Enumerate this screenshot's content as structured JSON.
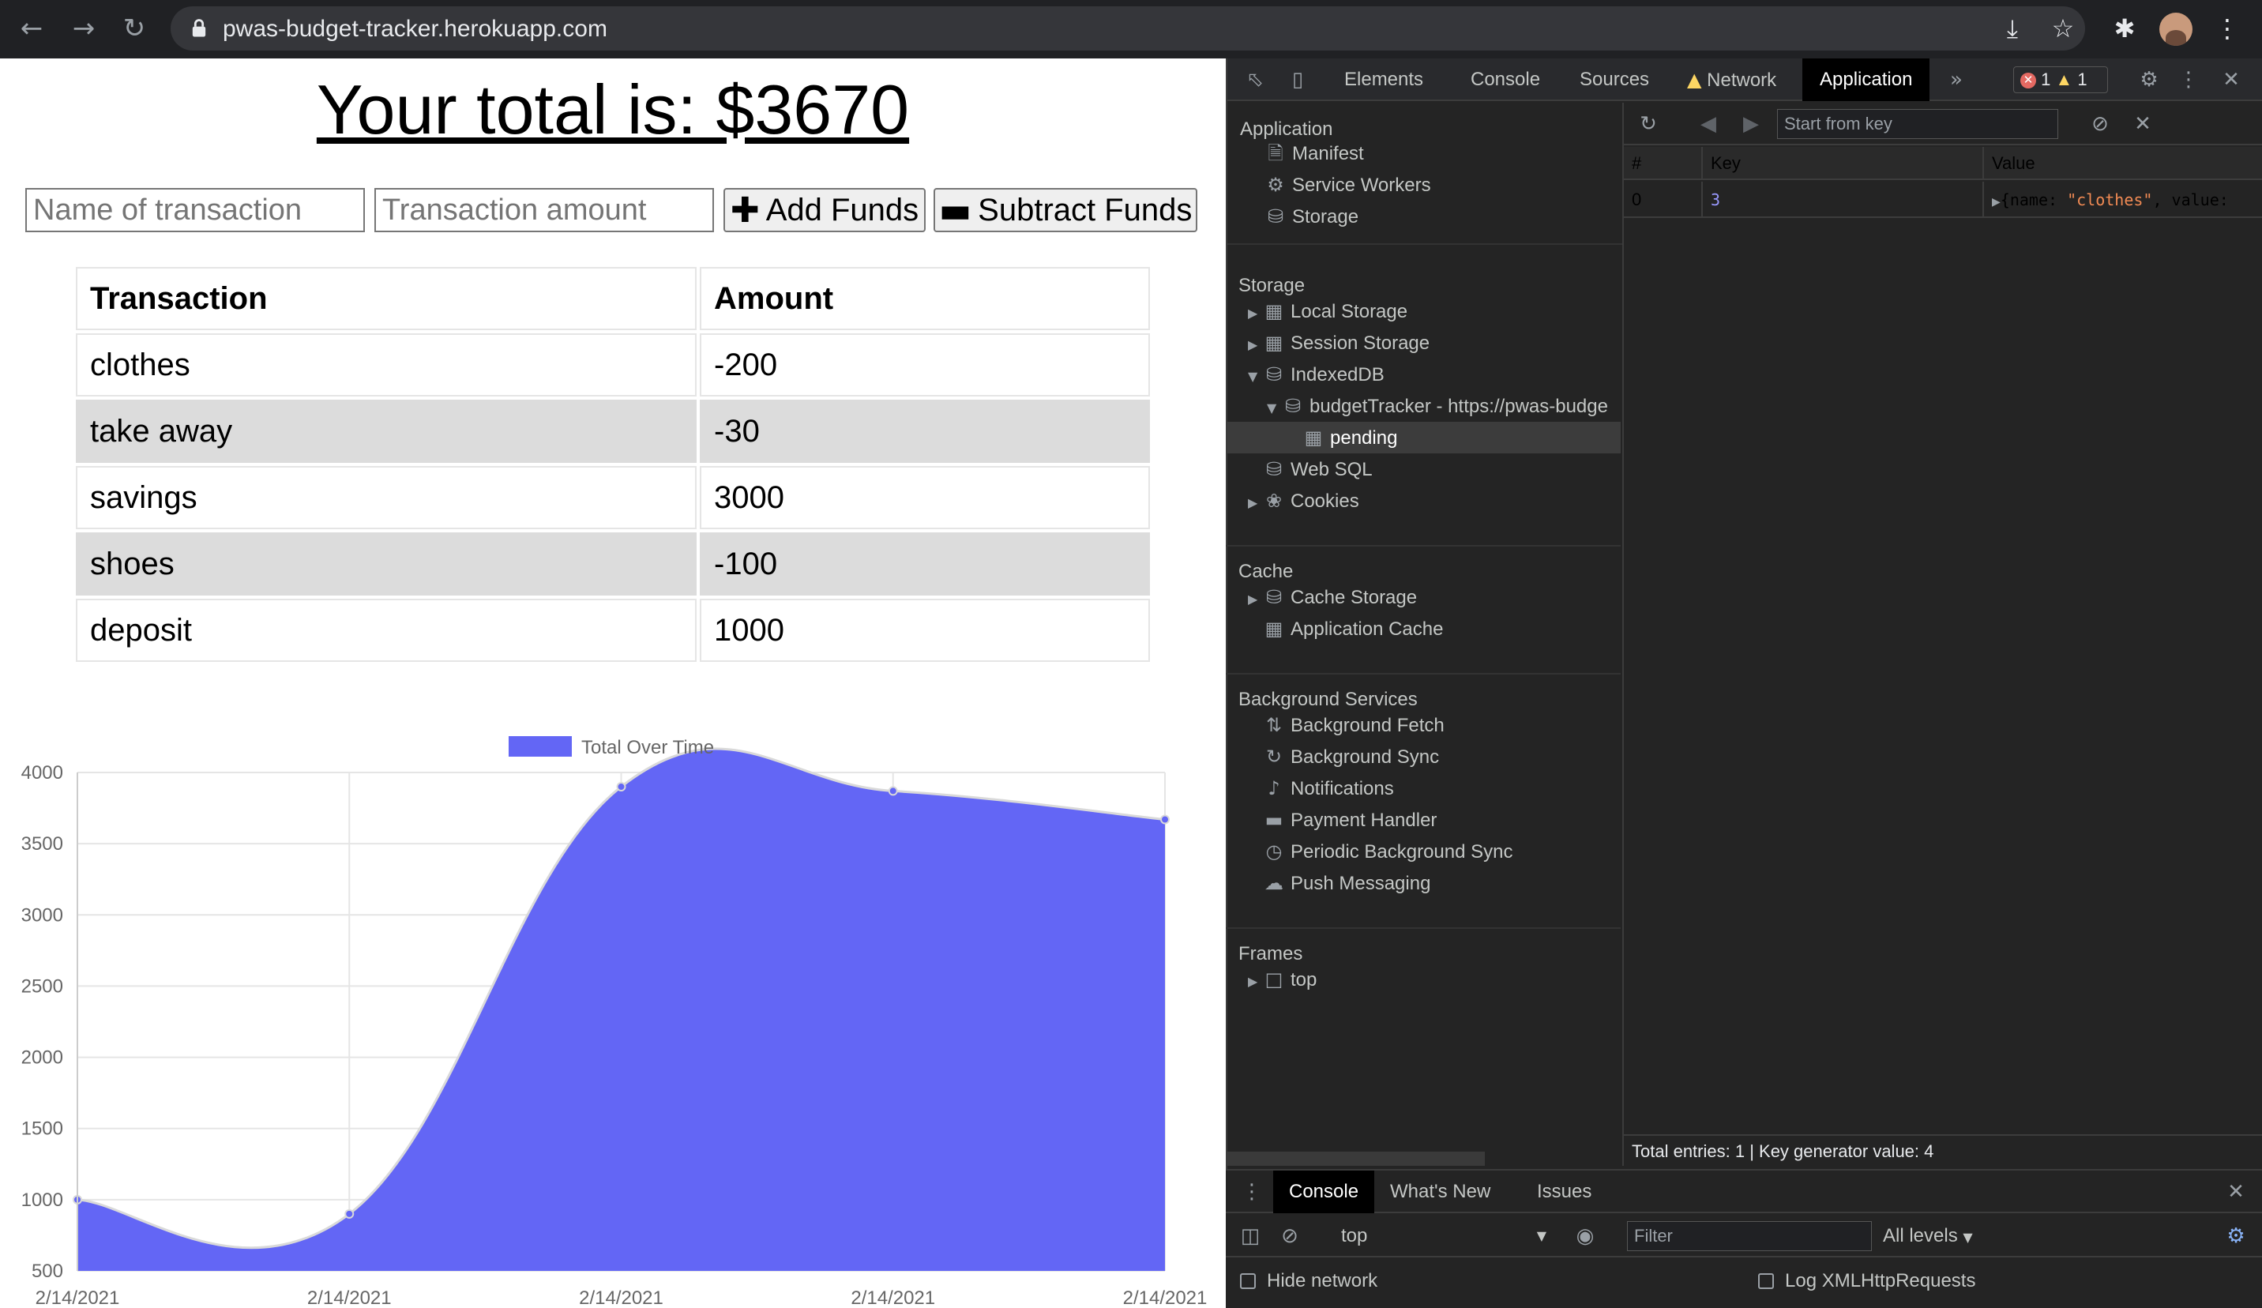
{
  "browser": {
    "url": "pwas-budget-tracker.herokuapp.com",
    "back_icon": "arrow-left",
    "forward_icon": "arrow-right",
    "reload_icon": "reload"
  },
  "page": {
    "total_text": "Your total is: $3670",
    "name_placeholder": "Name of transaction",
    "amount_placeholder": "Transaction amount",
    "add_label": "Add Funds",
    "subtract_label": "Subtract Funds",
    "table": {
      "headers": [
        "Transaction",
        "Amount"
      ],
      "rows": [
        {
          "name": "clothes",
          "amount": "-200"
        },
        {
          "name": "take away",
          "amount": "-30"
        },
        {
          "name": "savings",
          "amount": "3000"
        },
        {
          "name": "shoes",
          "amount": "-100"
        },
        {
          "name": "deposit",
          "amount": "1000"
        }
      ]
    }
  },
  "chart_data": {
    "type": "area",
    "legend": "Total Over Time",
    "x": [
      "2/14/2021",
      "2/14/2021",
      "2/14/2021",
      "2/14/2021",
      "2/14/2021"
    ],
    "series": [
      {
        "name": "Total Over Time",
        "values": [
          1000,
          900,
          3900,
          3870,
          3670
        ]
      }
    ],
    "ylim": [
      500,
      4000
    ],
    "yticks": [
      500,
      1000,
      1500,
      2000,
      2500,
      3000,
      3500,
      4000
    ],
    "fill_color": "#6366f5",
    "grid": true
  },
  "devtools": {
    "tabs": [
      "Elements",
      "Console",
      "Sources",
      "Network",
      "Application"
    ],
    "active_tab": "Application",
    "error_count": "1",
    "warning_count": "1",
    "sidebar": {
      "application_title": "Application",
      "application_items": [
        "Manifest",
        "Service Workers",
        "Storage"
      ],
      "storage_title": "Storage",
      "storage_items": {
        "local": "Local Storage",
        "session": "Session Storage",
        "indexeddb": "IndexedDB",
        "db": "budgetTracker - https://pwas-budge",
        "store": "pending",
        "websql": "Web SQL",
        "cookies": "Cookies"
      },
      "cache_title": "Cache",
      "cache_items": [
        "Cache Storage",
        "Application Cache"
      ],
      "bg_title": "Background Services",
      "bg_items": [
        "Background Fetch",
        "Background Sync",
        "Notifications",
        "Payment Handler",
        "Periodic Background Sync",
        "Push Messaging"
      ],
      "frames_title": "Frames",
      "frames_items": [
        "top"
      ]
    },
    "idb": {
      "start_key_placeholder": "Start from key",
      "headers": [
        "#",
        "Key",
        "Value"
      ],
      "row": {
        "index": "0",
        "key": "3",
        "value_prefix": "{name: ",
        "value_string": "\"clothes\"",
        "value_suffix": ", value:"
      },
      "footer": "Total entries: 1 | Key generator value: 4"
    },
    "drawer": {
      "tabs": [
        "Console",
        "What's New",
        "Issues"
      ],
      "context": "top",
      "filter_placeholder": "Filter",
      "levels": "All levels",
      "hide_network": "Hide network",
      "log_xhr": "Log XMLHttpRequests"
    }
  }
}
